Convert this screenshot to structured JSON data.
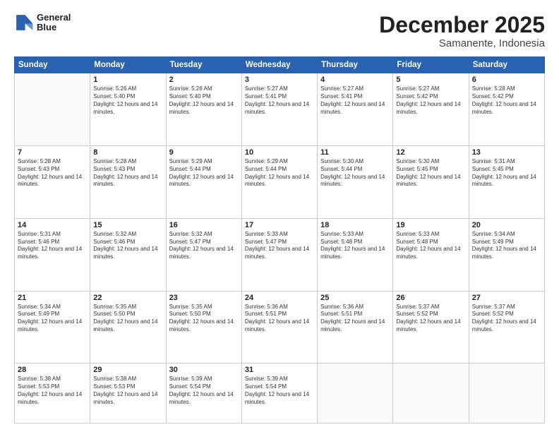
{
  "logo": {
    "line1": "General",
    "line2": "Blue"
  },
  "header": {
    "month": "December 2025",
    "location": "Samanente, Indonesia"
  },
  "weekdays": [
    "Sunday",
    "Monday",
    "Tuesday",
    "Wednesday",
    "Thursday",
    "Friday",
    "Saturday"
  ],
  "weeks": [
    [
      {
        "day": "",
        "sunrise": "",
        "sunset": "",
        "daylight": ""
      },
      {
        "day": "1",
        "sunrise": "Sunrise: 5:26 AM",
        "sunset": "Sunset: 5:40 PM",
        "daylight": "Daylight: 12 hours and 14 minutes."
      },
      {
        "day": "2",
        "sunrise": "Sunrise: 5:26 AM",
        "sunset": "Sunset: 5:40 PM",
        "daylight": "Daylight: 12 hours and 14 minutes."
      },
      {
        "day": "3",
        "sunrise": "Sunrise: 5:27 AM",
        "sunset": "Sunset: 5:41 PM",
        "daylight": "Daylight: 12 hours and 14 minutes."
      },
      {
        "day": "4",
        "sunrise": "Sunrise: 5:27 AM",
        "sunset": "Sunset: 5:41 PM",
        "daylight": "Daylight: 12 hours and 14 minutes."
      },
      {
        "day": "5",
        "sunrise": "Sunrise: 5:27 AM",
        "sunset": "Sunset: 5:42 PM",
        "daylight": "Daylight: 12 hours and 14 minutes."
      },
      {
        "day": "6",
        "sunrise": "Sunrise: 5:28 AM",
        "sunset": "Sunset: 5:42 PM",
        "daylight": "Daylight: 12 hours and 14 minutes."
      }
    ],
    [
      {
        "day": "7",
        "sunrise": "Sunrise: 5:28 AM",
        "sunset": "Sunset: 5:43 PM",
        "daylight": "Daylight: 12 hours and 14 minutes."
      },
      {
        "day": "8",
        "sunrise": "Sunrise: 5:28 AM",
        "sunset": "Sunset: 5:43 PM",
        "daylight": "Daylight: 12 hours and 14 minutes."
      },
      {
        "day": "9",
        "sunrise": "Sunrise: 5:29 AM",
        "sunset": "Sunset: 5:44 PM",
        "daylight": "Daylight: 12 hours and 14 minutes."
      },
      {
        "day": "10",
        "sunrise": "Sunrise: 5:29 AM",
        "sunset": "Sunset: 5:44 PM",
        "daylight": "Daylight: 12 hours and 14 minutes."
      },
      {
        "day": "11",
        "sunrise": "Sunrise: 5:30 AM",
        "sunset": "Sunset: 5:44 PM",
        "daylight": "Daylight: 12 hours and 14 minutes."
      },
      {
        "day": "12",
        "sunrise": "Sunrise: 5:30 AM",
        "sunset": "Sunset: 5:45 PM",
        "daylight": "Daylight: 12 hours and 14 minutes."
      },
      {
        "day": "13",
        "sunrise": "Sunrise: 5:31 AM",
        "sunset": "Sunset: 5:45 PM",
        "daylight": "Daylight: 12 hours and 14 minutes."
      }
    ],
    [
      {
        "day": "14",
        "sunrise": "Sunrise: 5:31 AM",
        "sunset": "Sunset: 5:46 PM",
        "daylight": "Daylight: 12 hours and 14 minutes."
      },
      {
        "day": "15",
        "sunrise": "Sunrise: 5:32 AM",
        "sunset": "Sunset: 5:46 PM",
        "daylight": "Daylight: 12 hours and 14 minutes."
      },
      {
        "day": "16",
        "sunrise": "Sunrise: 5:32 AM",
        "sunset": "Sunset: 5:47 PM",
        "daylight": "Daylight: 12 hours and 14 minutes."
      },
      {
        "day": "17",
        "sunrise": "Sunrise: 5:33 AM",
        "sunset": "Sunset: 5:47 PM",
        "daylight": "Daylight: 12 hours and 14 minutes."
      },
      {
        "day": "18",
        "sunrise": "Sunrise: 5:33 AM",
        "sunset": "Sunset: 5:48 PM",
        "daylight": "Daylight: 12 hours and 14 minutes."
      },
      {
        "day": "19",
        "sunrise": "Sunrise: 5:33 AM",
        "sunset": "Sunset: 5:48 PM",
        "daylight": "Daylight: 12 hours and 14 minutes."
      },
      {
        "day": "20",
        "sunrise": "Sunrise: 5:34 AM",
        "sunset": "Sunset: 5:49 PM",
        "daylight": "Daylight: 12 hours and 14 minutes."
      }
    ],
    [
      {
        "day": "21",
        "sunrise": "Sunrise: 5:34 AM",
        "sunset": "Sunset: 5:49 PM",
        "daylight": "Daylight: 12 hours and 14 minutes."
      },
      {
        "day": "22",
        "sunrise": "Sunrise: 5:35 AM",
        "sunset": "Sunset: 5:50 PM",
        "daylight": "Daylight: 12 hours and 14 minutes."
      },
      {
        "day": "23",
        "sunrise": "Sunrise: 5:35 AM",
        "sunset": "Sunset: 5:50 PM",
        "daylight": "Daylight: 12 hours and 14 minutes."
      },
      {
        "day": "24",
        "sunrise": "Sunrise: 5:36 AM",
        "sunset": "Sunset: 5:51 PM",
        "daylight": "Daylight: 12 hours and 14 minutes."
      },
      {
        "day": "25",
        "sunrise": "Sunrise: 5:36 AM",
        "sunset": "Sunset: 5:51 PM",
        "daylight": "Daylight: 12 hours and 14 minutes."
      },
      {
        "day": "26",
        "sunrise": "Sunrise: 5:37 AM",
        "sunset": "Sunset: 5:52 PM",
        "daylight": "Daylight: 12 hours and 14 minutes."
      },
      {
        "day": "27",
        "sunrise": "Sunrise: 5:37 AM",
        "sunset": "Sunset: 5:52 PM",
        "daylight": "Daylight: 12 hours and 14 minutes."
      }
    ],
    [
      {
        "day": "28",
        "sunrise": "Sunrise: 5:38 AM",
        "sunset": "Sunset: 5:53 PM",
        "daylight": "Daylight: 12 hours and 14 minutes."
      },
      {
        "day": "29",
        "sunrise": "Sunrise: 5:38 AM",
        "sunset": "Sunset: 5:53 PM",
        "daylight": "Daylight: 12 hours and 14 minutes."
      },
      {
        "day": "30",
        "sunrise": "Sunrise: 5:39 AM",
        "sunset": "Sunset: 5:54 PM",
        "daylight": "Daylight: 12 hours and 14 minutes."
      },
      {
        "day": "31",
        "sunrise": "Sunrise: 5:39 AM",
        "sunset": "Sunset: 5:54 PM",
        "daylight": "Daylight: 12 hours and 14 minutes."
      },
      {
        "day": "",
        "sunrise": "",
        "sunset": "",
        "daylight": ""
      },
      {
        "day": "",
        "sunrise": "",
        "sunset": "",
        "daylight": ""
      },
      {
        "day": "",
        "sunrise": "",
        "sunset": "",
        "daylight": ""
      }
    ]
  ]
}
